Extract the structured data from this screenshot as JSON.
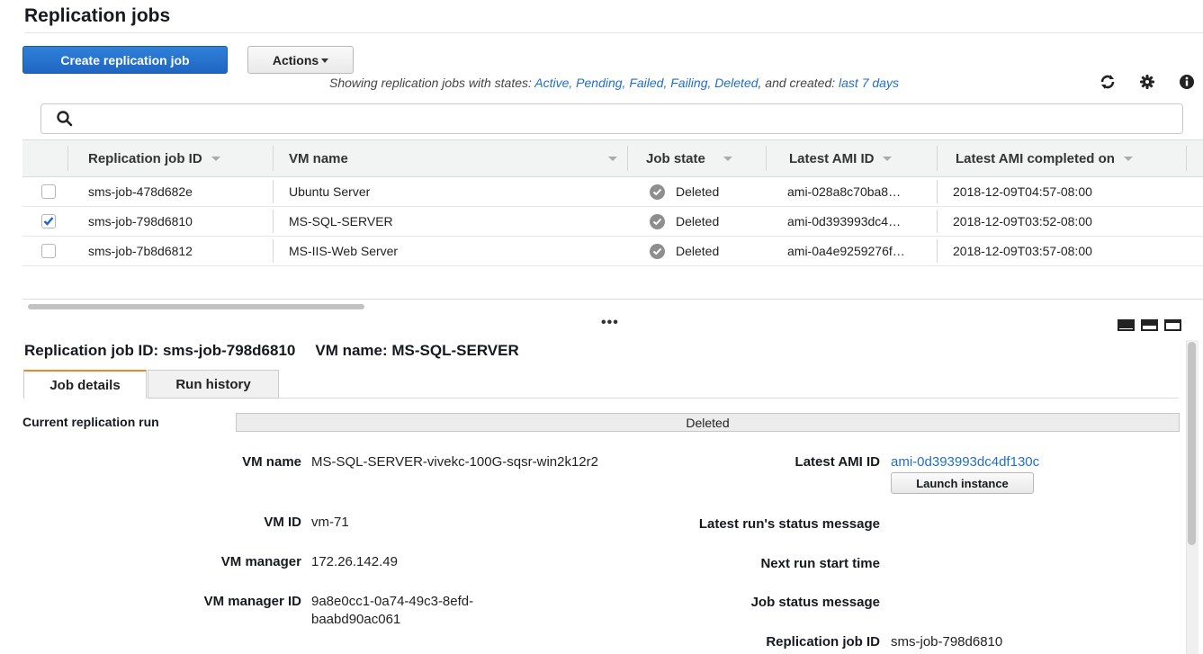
{
  "page": {
    "title": "Replication jobs"
  },
  "toolbar": {
    "create_label": "Create replication job",
    "actions_label": "Actions",
    "filter_prefix": "Showing replication jobs with states: ",
    "filter_states": "Active, Pending, Failed, Failing, Deleted",
    "filter_middle": ", and created: ",
    "filter_period": "last 7 days",
    "icons": [
      "refresh-icon",
      "gear-icon",
      "info-icon"
    ]
  },
  "search": {
    "placeholder": ""
  },
  "table": {
    "columns": [
      "Replication job ID",
      "VM name",
      "Job state",
      "Latest AMI ID",
      "Latest AMI completed on"
    ],
    "rows": [
      {
        "checked": false,
        "id": "sms-job-478d682e",
        "vm_name": "Ubuntu Server",
        "state": "Deleted",
        "ami": "ami-028a8c70ba8…",
        "completed": "2018-12-09T04:57-08:00"
      },
      {
        "checked": true,
        "id": "sms-job-798d6810",
        "vm_name": "MS-SQL-SERVER",
        "state": "Deleted",
        "ami": "ami-0d393993dc4…",
        "completed": "2018-12-09T03:52-08:00"
      },
      {
        "checked": false,
        "id": "sms-job-7b8d6812",
        "vm_name": "MS-IIS-Web Server",
        "state": "Deleted",
        "ami": "ami-0a4e9259276f…",
        "completed": "2018-12-09T03:57-08:00"
      }
    ]
  },
  "splitter": {
    "dots": "•••"
  },
  "detail": {
    "job_id_label": "Replication job ID: sms-job-798d6810",
    "vm_name_label": "VM name: MS-SQL-SERVER",
    "tabs": [
      "Job details",
      "Run history"
    ],
    "current_run_label": "Current replication run",
    "current_run_value": "Deleted",
    "left_fields": [
      {
        "label": "VM name",
        "value": "MS-SQL-SERVER-vivekc-100G-sqsr-win2k12r2"
      },
      {
        "label": "VM ID",
        "value": "vm-71"
      },
      {
        "label": "VM manager",
        "value": "172.26.142.49"
      },
      {
        "label": "VM manager ID",
        "value": "9a8e0cc1-0a74-49c3-8efd-baabd90ac061"
      }
    ],
    "right_fields": [
      {
        "label": "Latest AMI ID",
        "value": "ami-0d393993dc4df130c"
      },
      {
        "label": "Latest run's status message",
        "value": ""
      },
      {
        "label": "Next run start time",
        "value": ""
      },
      {
        "label": "Job status message",
        "value": ""
      },
      {
        "label": "Replication job ID",
        "value": "sms-job-798d6810"
      }
    ],
    "launch_label": "Launch instance"
  },
  "colors": {
    "primary": "#1f66c2",
    "link": "#1f6fc5",
    "tab_accent": "#e8882b"
  }
}
